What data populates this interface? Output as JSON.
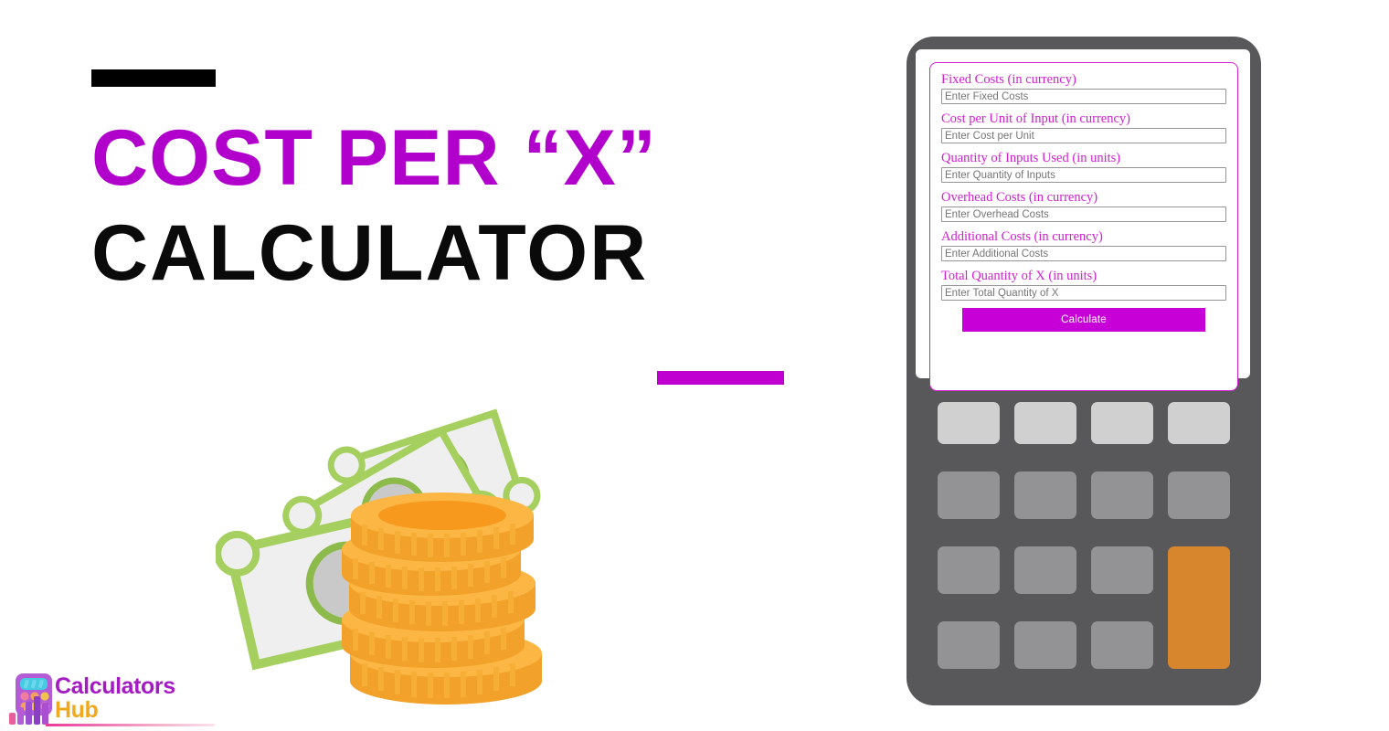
{
  "page": {
    "title_line_1": "COST PER “X”",
    "title_line_2": "CALCULATOR"
  },
  "colors": {
    "accent_magenta": "#B200CC",
    "button_magenta": "#C600D6",
    "label_magenta": "#D01FD0",
    "title_black": "#0A0A0A",
    "device_body": "#58585A",
    "key_light": "#D0D0D0",
    "key_mid": "#939395",
    "key_accent": "#D8862E",
    "bill_green": "#A5CF5E",
    "coin_gold": "#F9A827",
    "logo_purple": "#A41BC4",
    "logo_orange": "#F0A81E"
  },
  "decor": {
    "top_rule": "black-rule",
    "bottom_rule": "magenta-rule"
  },
  "illustration": {
    "name": "money-banknotes-and-coins",
    "banknote_count": 3,
    "coin_stack_count": 5
  },
  "logo": {
    "word_1": "Calculators",
    "word_2": "Hub",
    "icon": "calculator-bars-icon"
  },
  "calculator": {
    "form": {
      "fields": [
        {
          "label": "Fixed Costs (in currency)",
          "placeholder": "Enter Fixed Costs",
          "value": ""
        },
        {
          "label": "Cost per Unit of Input (in currency)",
          "placeholder": "Enter Cost per Unit",
          "value": ""
        },
        {
          "label": "Quantity of Inputs Used (in units)",
          "placeholder": "Enter Quantity of Inputs",
          "value": ""
        },
        {
          "label": "Overhead Costs (in currency)",
          "placeholder": "Enter Overhead Costs",
          "value": ""
        },
        {
          "label": "Additional Costs (in currency)",
          "placeholder": "Enter Additional Costs",
          "value": ""
        },
        {
          "label": "Total Quantity of X (in units)",
          "placeholder": "Enter Total Quantity of X",
          "value": ""
        }
      ],
      "submit_label": "Calculate"
    },
    "keypad": {
      "rows": 4,
      "columns": 4,
      "accent_key": "equals-key"
    }
  }
}
